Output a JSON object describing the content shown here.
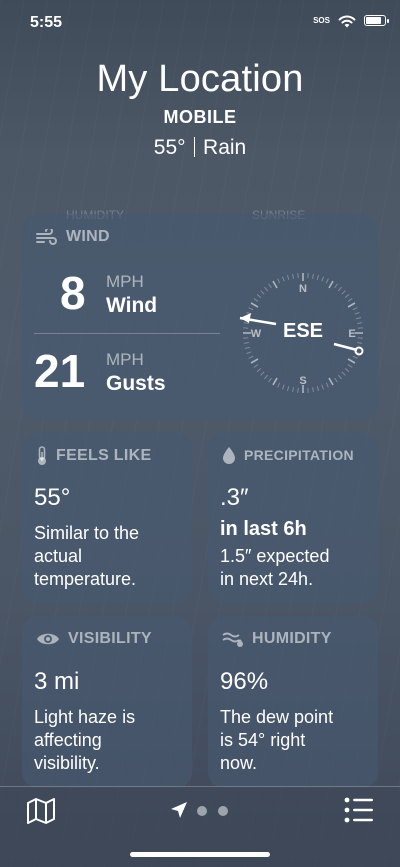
{
  "status_bar": {
    "time": "5:55",
    "carrier": "SOS",
    "battery_level": 0.95
  },
  "header": {
    "title": "My Location",
    "subtitle": "MOBILE",
    "temperature": "55°",
    "condition": "Rain"
  },
  "ghost_labels": {
    "left": "HUMIDITY",
    "right": "SUNRISE"
  },
  "wind": {
    "header": "WIND",
    "speed": "8",
    "speed_unit": "MPH",
    "speed_label": "Wind",
    "gust": "21",
    "gust_unit": "MPH",
    "gust_label": "Gusts",
    "direction": "ESE",
    "compass": {
      "n": "N",
      "e": "E",
      "s": "S",
      "w": "W"
    }
  },
  "feels_like": {
    "header": "FEELS LIKE",
    "value": "55°",
    "description_lines": [
      "Similar to the",
      "actual",
      "temperature."
    ]
  },
  "precipitation": {
    "header": "PRECIPITATION",
    "value": ".3″",
    "period": "in last 6h",
    "description_lines": [
      "1.5″ expected",
      "in next 24h."
    ]
  },
  "visibility": {
    "header": "VISIBILITY",
    "value": "3 mi",
    "description_lines": [
      "Light haze is",
      "affecting",
      "visibility."
    ]
  },
  "humidity": {
    "header": "HUMIDITY",
    "value": "96%",
    "description_lines": [
      "The dew point",
      "is 54° right",
      "now."
    ]
  },
  "tabbar": {
    "icons": [
      "map-icon",
      "location-arrow-icon",
      "page-dot",
      "page-dot",
      "list-icon"
    ]
  }
}
